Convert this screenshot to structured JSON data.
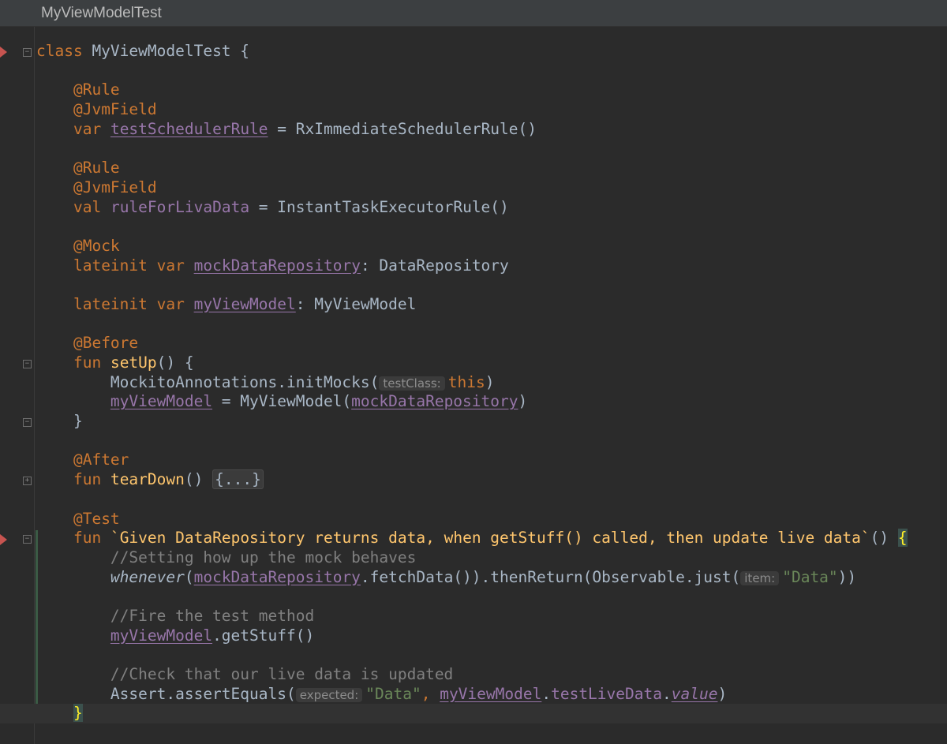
{
  "tab": {
    "title": "MyViewModelTest"
  },
  "code": {
    "l1": {
      "kw": "class",
      "name": " MyViewModelTest {"
    },
    "l3": "@Rule",
    "l4": "@JvmField",
    "l5": {
      "kw": "var",
      "prop": "testSchedulerRule",
      "rest": " = RxImmediateSchedulerRule()"
    },
    "l7": "@Rule",
    "l8": "@JvmField",
    "l9": {
      "kw": "val",
      "prop": "ruleForLivaData",
      "rest": " = InstantTaskExecutorRule()"
    },
    "l11": "@Mock",
    "l12": {
      "kw": "lateinit var",
      "prop": "mockDataRepository",
      "rest": ": DataRepository"
    },
    "l14": {
      "kw": "lateinit var",
      "prop": "myViewModel",
      "rest": ": MyViewModel"
    },
    "l16": "@Before",
    "l17": {
      "kw": "fun",
      "fn": "setUp",
      "rest": "() {"
    },
    "l18": {
      "pre": "MockitoAnnotations.initMocks(",
      "hint": "testClass:",
      "kw": "this",
      "post": ")"
    },
    "l19": {
      "prop1": "myViewModel",
      "mid": " = MyViewModel(",
      "prop2": "mockDataRepository",
      "post": ")"
    },
    "l20": "}",
    "l22": "@After",
    "l23": {
      "kw": "fun",
      "fn": "tearDown",
      "rest": "() ",
      "folded": "{...}"
    },
    "l25": "@Test",
    "l26": {
      "kw": "fun",
      "fn": "`Given DataRepository returns data, when getStuff() called, then update live data`",
      "rest": "() ",
      "brace": "{"
    },
    "l27": "//Setting how up the mock behaves",
    "l28": {
      "fn": "whenever",
      "p1": "(",
      "prop": "mockDataRepository",
      "mid": ".fetchData()).thenReturn(Observable.just(",
      "hint": "item:",
      "str": "\"Data\"",
      "post": "))"
    },
    "l30": "//Fire the test method",
    "l31": {
      "prop": "myViewModel",
      "rest": ".getStuff()"
    },
    "l33": "//Check that our live data is updated",
    "l34": {
      "pre": "Assert.assertEquals(",
      "hint": "expected:",
      "str": "\"Data\"",
      "c1": ", ",
      "prop1": "myViewModel",
      "dot": ".",
      "prop2": "testLiveData",
      "dot2": ".",
      "prop3": "value",
      "post": ")"
    },
    "l35": "}"
  }
}
